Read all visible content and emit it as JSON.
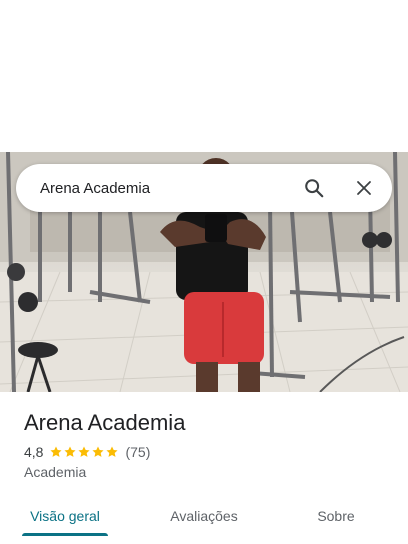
{
  "search": {
    "query": "Arena Academia"
  },
  "place": {
    "name": "Arena Academia",
    "rating": "4,8",
    "stars": 5,
    "reviews": "(75)",
    "category": "Academia"
  },
  "tabs": [
    {
      "label": "Visão geral",
      "active": true
    },
    {
      "label": "Avaliações",
      "active": false
    },
    {
      "label": "Sobre",
      "active": false
    }
  ],
  "colors": {
    "accent": "#0b7285",
    "star": "#fbbc04"
  },
  "icons": {
    "search": "search-icon",
    "close": "close-icon",
    "star": "star-icon"
  }
}
